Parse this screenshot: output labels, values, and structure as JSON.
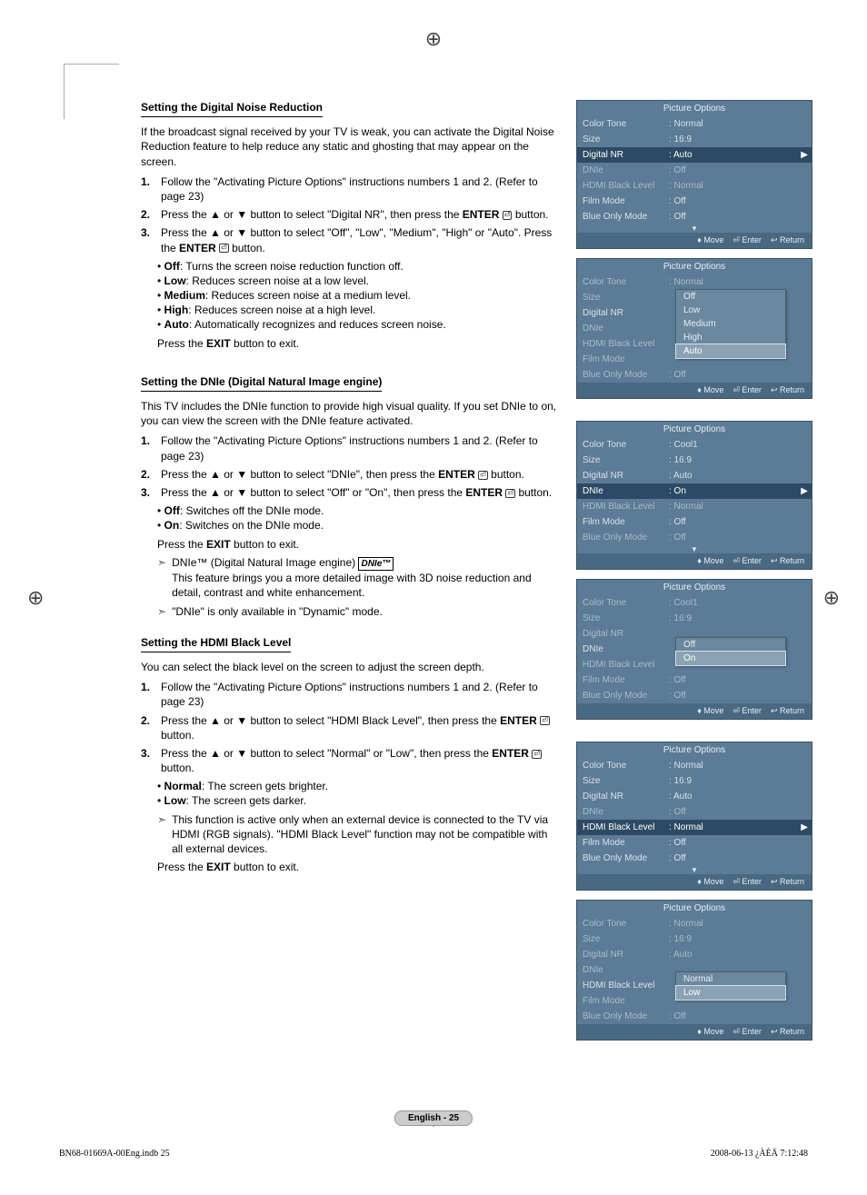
{
  "page": {
    "footer": "English - 25",
    "indb": "BN68-01669A-00Eng.indb   25",
    "timestamp": "2008-06-13   ¿ÀÈÄ 7:12:48"
  },
  "sec1": {
    "heading": "Setting the Digital Noise Reduction",
    "intro": "If the broadcast signal received by your TV is weak, you can activate the Digital Noise Reduction feature to help reduce any static and ghosting that may appear on the screen.",
    "s1": "Follow the \"Activating Picture Options\" instructions numbers 1 and 2. (Refer to page 23)",
    "s2a": "Press the ▲ or ▼ button to select \"Digital NR\", then press the ",
    "s2b": " button.",
    "s3a": "Press the ▲ or ▼ button to select \"Off\", \"Low\", \"Medium\", \"High\" or \"Auto\". Press the ",
    "s3b": " button.",
    "b1": "Off: Turns the screen noise reduction function off.",
    "b2": "Low: Reduces screen noise at a low level.",
    "b3": "Medium: Reduces screen noise at a medium level.",
    "b4": "High: Reduces screen noise at a high level.",
    "b5": "Auto: Automatically recognizes and reduces screen noise.",
    "exit": "Press the EXIT button to exit."
  },
  "sec2": {
    "heading": "Setting the DNIe (Digital Natural Image engine)",
    "intro": "This TV includes the DNIe function to provide high visual quality. If you set DNIe to on, you can view the screen with the DNIe feature activated.",
    "s1": "Follow the \"Activating Picture Options\" instructions numbers 1 and 2. (Refer to page 23)",
    "s2a": "Press the ▲ or ▼ button to select \"DNIe\", then press the ",
    "s2b": " button.",
    "s3a": "Press the ▲ or ▼ button to select \"Off\" or \"On\", then press the ",
    "s3b": " button.",
    "b1": "Off: Switches off the DNIe mode.",
    "b2": "On: Switches on the DNIe mode.",
    "exit": "Press the EXIT button to exit.",
    "n1a": "DNIe™ (Digital Natural Image engine) ",
    "n1badge": "DNIe™",
    "n1b": "This feature brings you a more detailed image with 3D noise reduction and detail, contrast and white enhancement.",
    "n2": "\"DNIe\" is only available in \"Dynamic\" mode."
  },
  "sec3": {
    "heading": "Setting the HDMI Black Level",
    "intro": "You can select the black level on the screen to adjust the screen depth.",
    "s1": "Follow the \"Activating Picture Options\" instructions numbers 1 and 2. (Refer to page 23)",
    "s2a": "Press the ▲ or ▼ button to select \"HDMI Black Level\", then press the ",
    "s2b": " button.",
    "s3a": "Press the ▲ or ▼ button to select \"Normal\" or \"Low\", then press the ",
    "s3b": " button.",
    "b1": "Normal: The screen gets brighter.",
    "b2": "Low: The screen gets darker.",
    "n1": "This function is active only when an external device is connected to the TV via HDMI (RGB signals). \"HDMI Black Level\" function may not be compatible with all external devices.",
    "exit": "Press the EXIT button to exit."
  },
  "common": {
    "enter": "ENTER",
    "enter_glyph": "⏎"
  },
  "osd": {
    "title": "Picture Options",
    "foot_move": "Move",
    "foot_enter": "Enter",
    "foot_return": "Return",
    "rows": {
      "color_tone": "Color Tone",
      "size": "Size",
      "digital_nr": "Digital NR",
      "dnie": "DNIe",
      "hdmi_black": "HDMI Black Level",
      "film_mode": "Film Mode",
      "blue_only": "Blue Only Mode"
    },
    "vals": {
      "normal": ": Normal",
      "r169": ": 16:9",
      "auto": ": Auto",
      "off": ": Off",
      "on": ": On",
      "cool1": ": Cool1"
    },
    "popup_nr": [
      "Off",
      "Low",
      "Medium",
      "High",
      "Auto"
    ],
    "popup_dnie": [
      "Off",
      "On"
    ],
    "popup_hdmi": [
      "Normal",
      "Low"
    ]
  }
}
